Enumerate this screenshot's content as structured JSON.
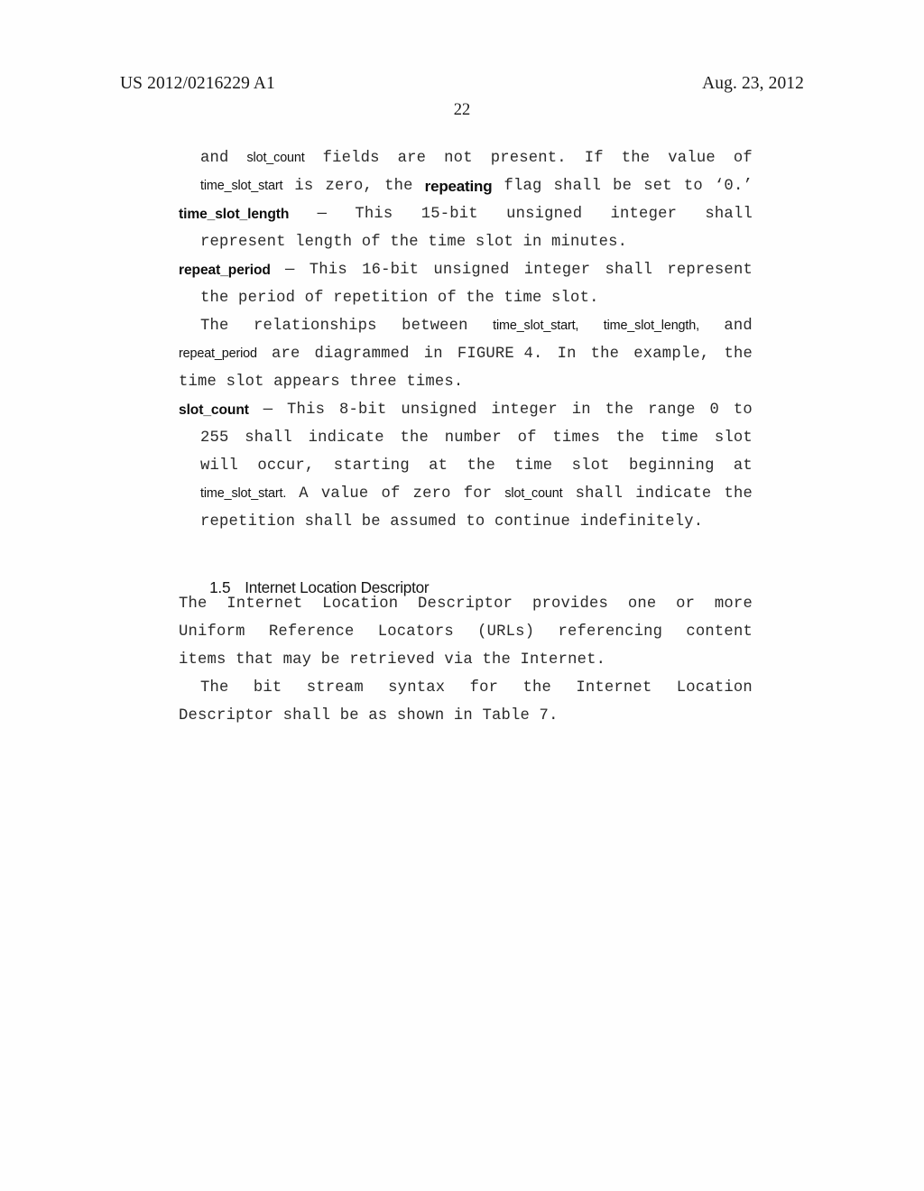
{
  "document": {
    "publication_number": "US 2012/0216229 A1",
    "publication_date": "Aug. 23, 2012",
    "page_number": "22"
  },
  "body": {
    "lines": [
      {
        "id": "l1",
        "indent": "indent-1",
        "justified": true,
        "segments": [
          {
            "t": "and",
            "s": "mono"
          },
          {
            "t": "slot_count",
            "s": "fld"
          },
          {
            "t": "fields",
            "s": "mono"
          },
          {
            "t": "are",
            "s": "mono"
          },
          {
            "t": "not",
            "s": "mono"
          },
          {
            "t": "present.",
            "s": "mono"
          },
          {
            "t": "If",
            "s": "mono"
          },
          {
            "t": "the",
            "s": "mono"
          },
          {
            "t": "value",
            "s": "mono"
          },
          {
            "t": "of",
            "s": "mono"
          }
        ]
      },
      {
        "id": "l2",
        "indent": "indent-1",
        "justified": true,
        "segments": [
          {
            "t": "time_slot_start",
            "s": "fld"
          },
          {
            "t": "is",
            "s": "mono"
          },
          {
            "t": "zero,",
            "s": "mono"
          },
          {
            "t": "the",
            "s": "mono"
          },
          {
            "t": "repeating",
            "s": "sans-b-lg"
          },
          {
            "t": "flag",
            "s": "mono"
          },
          {
            "t": "shall",
            "s": "mono"
          },
          {
            "t": "be",
            "s": "mono"
          },
          {
            "t": "set",
            "s": "mono"
          },
          {
            "t": "to",
            "s": "mono"
          },
          {
            "t": "‘0.’",
            "s": "mono"
          }
        ]
      },
      {
        "id": "l3",
        "indent": "indent-2",
        "justified": true,
        "segments": [
          {
            "t": "time_slot_length",
            "s": "fld-b"
          },
          {
            "t": "—",
            "s": "mono"
          },
          {
            "t": "This",
            "s": "mono"
          },
          {
            "t": "15-bit",
            "s": "mono"
          },
          {
            "t": "unsigned",
            "s": "mono"
          },
          {
            "t": "integer",
            "s": "mono"
          },
          {
            "t": "shall",
            "s": "mono"
          }
        ]
      },
      {
        "id": "l4",
        "indent": "hang",
        "justified": false,
        "segments": [
          {
            "t": "represent length of the time slot in minutes.",
            "s": "mono"
          }
        ]
      },
      {
        "id": "l5",
        "indent": "indent-2",
        "justified": true,
        "segments": [
          {
            "t": "repeat_period",
            "s": "fld-b"
          },
          {
            "t": "—",
            "s": "mono"
          },
          {
            "t": "This",
            "s": "mono"
          },
          {
            "t": "16-bit",
            "s": "mono"
          },
          {
            "t": "unsigned",
            "s": "mono"
          },
          {
            "t": "integer",
            "s": "mono"
          },
          {
            "t": "shall",
            "s": "mono"
          },
          {
            "t": "represent",
            "s": "mono"
          }
        ]
      },
      {
        "id": "l6",
        "indent": "hang",
        "justified": false,
        "segments": [
          {
            "t": "the period of repetition of the time slot.",
            "s": "mono"
          }
        ]
      },
      {
        "id": "l7",
        "indent": "indent-1",
        "justified": true,
        "segments": [
          {
            "t": "The",
            "s": "mono"
          },
          {
            "t": "relationships",
            "s": "mono"
          },
          {
            "t": "between",
            "s": "mono"
          },
          {
            "t": "time_slot_start,",
            "s": "fld"
          },
          {
            "t": "time_slot_length,",
            "s": "fld"
          },
          {
            "t": "and",
            "s": "mono"
          }
        ]
      },
      {
        "id": "l8",
        "indent": "indent-2",
        "justified": true,
        "segments": [
          {
            "t": "repeat_period",
            "s": "fld"
          },
          {
            "t": "are",
            "s": "mono"
          },
          {
            "t": "diagrammed",
            "s": "mono"
          },
          {
            "t": "in",
            "s": "mono"
          },
          {
            "t": "FIGURE 4.",
            "s": "mono-b"
          },
          {
            "t": "In",
            "s": "mono"
          },
          {
            "t": "the",
            "s": "mono"
          },
          {
            "t": "example,",
            "s": "mono"
          },
          {
            "t": "the",
            "s": "mono"
          }
        ]
      },
      {
        "id": "l9",
        "indent": "indent-2",
        "justified": false,
        "segments": [
          {
            "t": "time slot appears three times.",
            "s": "mono"
          }
        ]
      },
      {
        "id": "l10",
        "indent": "indent-2",
        "justified": true,
        "segments": [
          {
            "t": "slot_count",
            "s": "fld-b"
          },
          {
            "t": "—",
            "s": "mono"
          },
          {
            "t": "This",
            "s": "mono"
          },
          {
            "t": "8-bit",
            "s": "mono"
          },
          {
            "t": "unsigned",
            "s": "mono"
          },
          {
            "t": "integer",
            "s": "mono"
          },
          {
            "t": "in",
            "s": "mono"
          },
          {
            "t": "the",
            "s": "mono"
          },
          {
            "t": "range",
            "s": "mono"
          },
          {
            "t": "0",
            "s": "mono"
          },
          {
            "t": "to",
            "s": "mono"
          }
        ]
      },
      {
        "id": "l11",
        "indent": "hang",
        "justified": true,
        "segments": [
          {
            "t": "255",
            "s": "mono"
          },
          {
            "t": "shall",
            "s": "mono"
          },
          {
            "t": "indicate",
            "s": "mono"
          },
          {
            "t": "the",
            "s": "mono"
          },
          {
            "t": "number",
            "s": "mono"
          },
          {
            "t": "of",
            "s": "mono"
          },
          {
            "t": "times",
            "s": "mono"
          },
          {
            "t": "the",
            "s": "mono"
          },
          {
            "t": "time",
            "s": "mono"
          },
          {
            "t": "slot",
            "s": "mono"
          }
        ]
      },
      {
        "id": "l12",
        "indent": "hang",
        "justified": true,
        "segments": [
          {
            "t": "will",
            "s": "mono"
          },
          {
            "t": "occur,",
            "s": "mono"
          },
          {
            "t": "starting",
            "s": "mono"
          },
          {
            "t": "at",
            "s": "mono"
          },
          {
            "t": "the",
            "s": "mono"
          },
          {
            "t": "time",
            "s": "mono"
          },
          {
            "t": "slot",
            "s": "mono"
          },
          {
            "t": "beginning",
            "s": "mono"
          },
          {
            "t": "at",
            "s": "mono"
          }
        ]
      },
      {
        "id": "l13",
        "indent": "hang",
        "justified": true,
        "segments": [
          {
            "t": "time_slot_start.",
            "s": "fld"
          },
          {
            "t": "A",
            "s": "mono"
          },
          {
            "t": "value",
            "s": "mono"
          },
          {
            "t": "of",
            "s": "mono"
          },
          {
            "t": "zero",
            "s": "mono"
          },
          {
            "t": "for",
            "s": "mono"
          },
          {
            "t": "slot_count",
            "s": "fld"
          },
          {
            "t": "shall",
            "s": "mono"
          },
          {
            "t": "indicate",
            "s": "mono"
          },
          {
            "t": "the",
            "s": "mono"
          }
        ]
      },
      {
        "id": "l14",
        "indent": "hang",
        "justified": false,
        "segments": [
          {
            "t": "repetition shall be assumed to continue indefinitely.",
            "s": "mono"
          }
        ]
      }
    ]
  },
  "section": {
    "number": "1.5",
    "title": "Internet Location Descriptor"
  },
  "body2": {
    "lines": [
      {
        "id": "m1",
        "indent": "indent-2",
        "justified": true,
        "segments": [
          {
            "t": "The",
            "s": "mono"
          },
          {
            "t": "Internet",
            "s": "mono"
          },
          {
            "t": "Location",
            "s": "mono"
          },
          {
            "t": "Descriptor",
            "s": "mono"
          },
          {
            "t": "provides",
            "s": "mono"
          },
          {
            "t": "one",
            "s": "mono"
          },
          {
            "t": "or",
            "s": "mono"
          },
          {
            "t": "more",
            "s": "mono"
          }
        ]
      },
      {
        "id": "m2",
        "indent": "indent-2",
        "justified": true,
        "segments": [
          {
            "t": "Uniform",
            "s": "mono"
          },
          {
            "t": "Reference",
            "s": "mono"
          },
          {
            "t": "Locators",
            "s": "mono"
          },
          {
            "t": "(URLs)",
            "s": "mono"
          },
          {
            "t": "referencing",
            "s": "mono"
          },
          {
            "t": "content",
            "s": "mono"
          }
        ]
      },
      {
        "id": "m3",
        "indent": "indent-2",
        "justified": false,
        "segments": [
          {
            "t": "items that may be retrieved via the Internet.",
            "s": "mono"
          }
        ]
      },
      {
        "id": "m4",
        "indent": "indent-1",
        "justified": true,
        "segments": [
          {
            "t": "The",
            "s": "mono"
          },
          {
            "t": "bit",
            "s": "mono"
          },
          {
            "t": "stream",
            "s": "mono"
          },
          {
            "t": "syntax",
            "s": "mono"
          },
          {
            "t": "for",
            "s": "mono"
          },
          {
            "t": "the",
            "s": "mono"
          },
          {
            "t": "Internet",
            "s": "mono"
          },
          {
            "t": "Location",
            "s": "mono"
          }
        ]
      },
      {
        "id": "m5",
        "indent": "indent-2",
        "justified": false,
        "segments": [
          {
            "t": "Descriptor shall be as shown in ",
            "s": "mono"
          },
          {
            "t": "Table 7",
            "s": "mono-b"
          },
          {
            "t": ".",
            "s": "mono"
          }
        ]
      }
    ]
  }
}
